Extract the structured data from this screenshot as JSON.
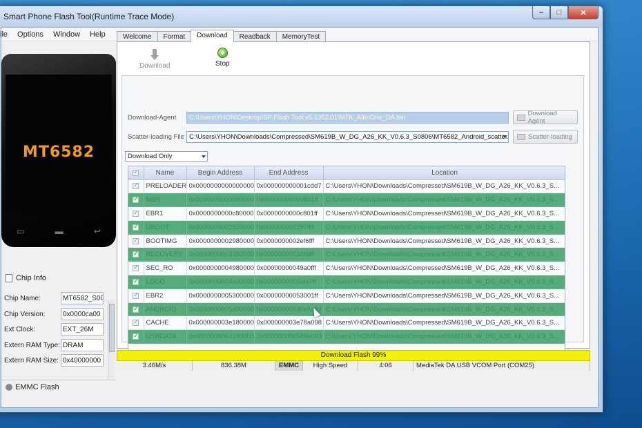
{
  "window": {
    "title": "Smart Phone Flash Tool(Runtime Trace Mode)"
  },
  "menu": [
    "ile",
    "Options",
    "Window",
    "Help"
  ],
  "phone": {
    "label": "MT6582"
  },
  "chip_info": {
    "header": "Chip Info",
    "rows": [
      {
        "label": "Chip Name:",
        "value": "MT6582_S00"
      },
      {
        "label": "Chip Version:",
        "value": "0x0000ca00"
      },
      {
        "label": "Ext Clock:",
        "value": "EXT_26M"
      },
      {
        "label": "Extern RAM Type:",
        "value": "DRAM"
      },
      {
        "label": "Extern RAM Size:",
        "value": "0x40000000"
      }
    ]
  },
  "emmc": {
    "header": "EMMC Flash"
  },
  "tabs": [
    "Welcome",
    "Format",
    "Download",
    "Readback",
    "MemoryTest"
  ],
  "active_tab": "Download",
  "toolbar": {
    "download_label": "Download",
    "stop_label": "Stop"
  },
  "download_agent": {
    "label": "Download-Agent",
    "value": "C:\\Users\\YHON\\Desktop\\SP Flash Tool v5.1352.01\\MTK_AllInOne_DA.bin",
    "button": "Download Agent"
  },
  "scatter": {
    "label": "Scatter-loading File",
    "value": "C:\\Users\\YHON\\Downloads\\Compressed\\SM619B_W_DG_A26_KK_V0.6.3_S0806\\MT6582_Android_scatter.txt",
    "button": "Scatter-loading"
  },
  "mode": {
    "selected": "Download Only"
  },
  "table": {
    "headers": [
      "Name",
      "Begin Address",
      "End Address",
      "Location"
    ],
    "rows": [
      {
        "name": "PRELOADER",
        "begin": "0x0000000000000000",
        "end": "0x000000000001cdd7",
        "location": "C:\\Users\\YHON\\Downloads\\Compressed\\SM619B_W_DG_A26_KK_V0.6.3_S..."
      },
      {
        "name": "MBR",
        "begin": "0x0000000000080000",
        "end": "0x00000000000801ff",
        "location": "C:\\Users\\YHON\\Downloads\\Compressed\\SM619B_W_DG_A26_KK_V0.6.3_S..."
      },
      {
        "name": "EBR1",
        "begin": "0x0000000000c80000",
        "end": "0x0000000000c801ff",
        "location": "C:\\Users\\YHON\\Downloads\\Compressed\\SM619B_W_DG_A26_KK_V0.6.3_S..."
      },
      {
        "name": "UBOOT",
        "begin": "0x0000000002920000",
        "end": "0x000000000297ffff",
        "location": "C:\\Users\\YHON\\Downloads\\Compressed\\SM619B_W_DG_A26_KK_V0.6.3_S..."
      },
      {
        "name": "BOOTIMG",
        "begin": "0x0000000002980000",
        "end": "0x0000000002ef6fff",
        "location": "C:\\Users\\YHON\\Downloads\\Compressed\\SM619B_W_DG_A26_KK_V0.6.3_S..."
      },
      {
        "name": "RECOVERY",
        "begin": "0x0000000003380000",
        "end": "0x00000000038f6fff",
        "location": "C:\\Users\\YHON\\Downloads\\Compressed\\SM619B_W_DG_A26_KK_V0.6.3_S..."
      },
      {
        "name": "SEC_RO",
        "begin": "0x0000000004980000",
        "end": "0x00000000049a0fff",
        "location": "C:\\Users\\YHON\\Downloads\\Compressed\\SM619B_W_DG_A26_KK_V0.6.3_S..."
      },
      {
        "name": "LOGO",
        "begin": "0x0000000004e00000",
        "end": "0x00000000050fa7ff",
        "location": "C:\\Users\\YHON\\Downloads\\Compressed\\SM619B_W_DG_A26_KK_V0.6.3_S..."
      },
      {
        "name": "EBR2",
        "begin": "0x0000000005300000",
        "end": "0x00000000053001ff",
        "location": "C:\\Users\\YHON\\Downloads\\Compressed\\SM619B_W_DG_A26_KK_V0.6.3_S..."
      },
      {
        "name": "ANDROID",
        "begin": "0x0000000005d00000",
        "end": "0x00000000330e6a83",
        "location": "C:\\Users\\YHON\\Downloads\\Compressed\\SM619B_W_DG_A26_KK_V0.6.3_S..."
      },
      {
        "name": "CACHE",
        "begin": "0x000000003e180000",
        "end": "0x000000003e78a098",
        "location": "C:\\Users\\YHON\\Downloads\\Compressed\\SM619B_W_DG_A26_KK_V0.6.3_S..."
      },
      {
        "name": "USRDATA",
        "begin": "0x0000000064180000",
        "end": "0x000000006589e093",
        "location": "C:\\Users\\YHON\\Downloads\\Compressed\\SM619B_W_DG_A26_KK_V0.6.3_S..."
      }
    ]
  },
  "progress": {
    "label": "Download Flash 99%",
    "percent": 99
  },
  "status": {
    "speed": "3.46M/s",
    "size": "836.38M",
    "storage": "EMMC",
    "usb_speed": "High Speed",
    "time": "4:06",
    "port": "MediaTek DA USB VCOM Port (COM25)"
  },
  "colors": {
    "progress": "#f2f200",
    "row_highlight": "#55ad7b"
  }
}
